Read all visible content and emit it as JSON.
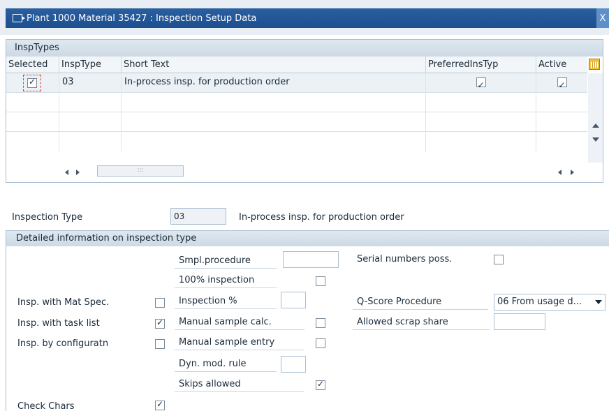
{
  "window": {
    "title": "Plant 1000 Material 35427 : Inspection Setup Data",
    "close_glyph": "X"
  },
  "table": {
    "caption": "InspTypes",
    "columns": [
      "Selected",
      "InspType",
      "Short Text",
      "PreferredInsTyp",
      "Active"
    ],
    "rows": [
      {
        "selected": true,
        "insp_type": "03",
        "short_text": "In-process insp. for production order",
        "preferred": true,
        "active": true
      }
    ],
    "empty_rows": 3
  },
  "inspection_type": {
    "label": "Inspection Type",
    "value": "03",
    "description": "In-process insp. for production order"
  },
  "detail": {
    "header": "Detailed information on inspection type",
    "left": [
      {
        "label": "Insp. with Mat Spec.",
        "checked": false
      },
      {
        "label": "Insp. with task list",
        "checked": true
      },
      {
        "label": "Insp. by configuratn",
        "checked": false
      }
    ],
    "check_chars": {
      "label": "Check Chars",
      "checked": true
    },
    "middle": {
      "smpl_procedure": {
        "label": "Smpl.procedure",
        "value": ""
      },
      "inspection_100": {
        "label": "100% inspection",
        "checked": false
      },
      "inspection_pct": {
        "label": "Inspection %",
        "value": ""
      },
      "manual_sample_calc": {
        "label": "Manual sample calc.",
        "checked": false
      },
      "manual_sample_entry": {
        "label": "Manual sample entry",
        "checked": false
      },
      "dyn_mod_rule": {
        "label": "Dyn. mod. rule",
        "value": ""
      },
      "skips_allowed": {
        "label": "Skips allowed",
        "checked": true
      }
    },
    "right": {
      "serial_numbers": {
        "label": "Serial numbers poss.",
        "checked": false
      },
      "qscore_procedure": {
        "label": "Q-Score Procedure",
        "value": "06 From usage d..."
      },
      "allowed_scrap": {
        "label": "Allowed scrap share",
        "value": ""
      }
    }
  },
  "colors": {
    "title_bar": "#1d4f8f",
    "header_bg": "#dfe8f0",
    "focus": "#d63a2a",
    "border": "#a9bfd3"
  }
}
